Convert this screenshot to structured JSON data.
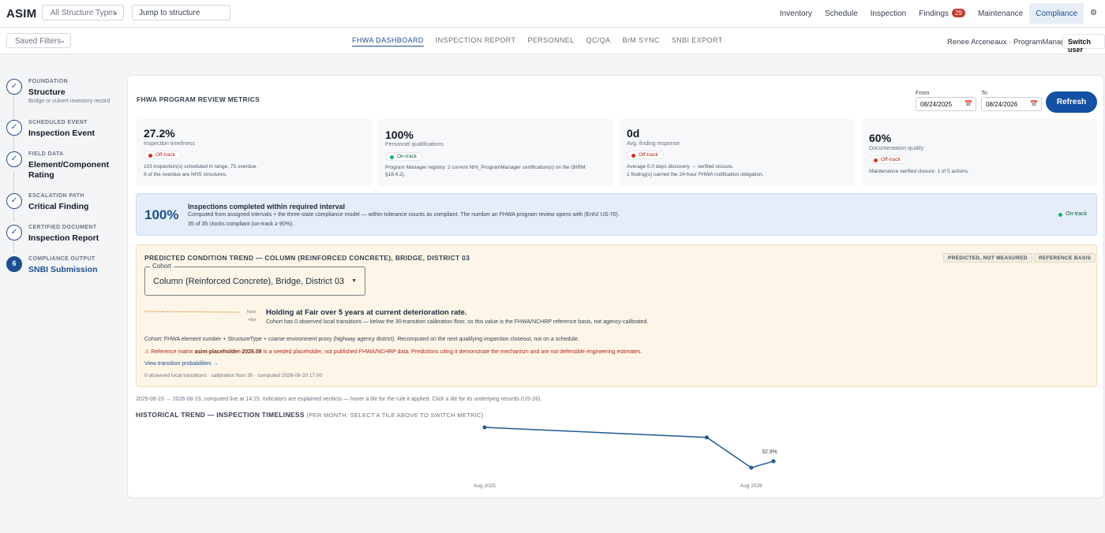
{
  "brand": "ASIM",
  "structure_select": "All Structure Types",
  "jump_placeholder": "Jump to structure",
  "topnav": {
    "inventory": "Inventory",
    "schedule": "Schedule",
    "inspection": "Inspection",
    "findings": "Findings",
    "findings_count": "29",
    "maintenance": "Maintenance",
    "compliance": "Compliance",
    "settings_icon": "gear-icon"
  },
  "subbar": {
    "saved_filters": "Saved Filters",
    "tabs": [
      "FHWA DASHBOARD",
      "INSPECTION REPORT",
      "PERSONNEL",
      "QC/QA",
      "BrM SYNC",
      "SNBI EXPORT"
    ],
    "active_tab": "FHWA DASHBOARD",
    "user": "Renee Arceneaux · ProgramManager",
    "switch_user": "Switch user"
  },
  "stepper": [
    {
      "category": "FOUNDATION",
      "title": "Structure",
      "desc": "Bridge or culvert inventory record",
      "mark": "✓"
    },
    {
      "category": "SCHEDULED EVENT",
      "title": "Inspection Event",
      "mark": "✓"
    },
    {
      "category": "FIELD DATA",
      "title": "Element/Component Rating",
      "mark": "✓"
    },
    {
      "category": "ESCALATION PATH",
      "title": "Critical Finding",
      "mark": "✓"
    },
    {
      "category": "CERTIFIED DOCUMENT",
      "title": "Inspection Report",
      "mark": "✓"
    },
    {
      "category": "COMPLIANCE OUTPUT",
      "title": "SNBI Submission",
      "mark": "6"
    }
  ],
  "dashboard": {
    "title": "FHWA PROGRAM REVIEW METRICS",
    "from_label": "From",
    "from_value": "08/24/2025",
    "to_label": "To",
    "to_value": "08/24/2026",
    "refresh": "Refresh"
  },
  "metrics": [
    {
      "value": "27.2%",
      "label": "Inspection timeliness",
      "status": "Off-track",
      "status_type": "off",
      "notes": [
        "103 inspection(s) scheduled in range, 75 overdue.",
        "9 of the overdue are NHS structures."
      ]
    },
    {
      "value": "100%",
      "label": "Personnel qualifications",
      "status": "On-track",
      "status_type": "on",
      "notes": [
        "Program Manager registry: 2 current NHI_ProgramManager certification(s) on file (BIRM",
        "§18.4.2)."
      ]
    },
    {
      "value": "0d",
      "label": "Avg. finding response",
      "status": "Off-track",
      "status_type": "off",
      "notes": [
        "Average 0.0 days discovery → verified closure.",
        "1 finding(s) carried the 24-hour FHWA notification obligation."
      ]
    },
    {
      "value": "60%",
      "label": "Documentation quality",
      "status": "Off-track",
      "status_type": "off",
      "notes": [
        "Maintenance verified closure: 1 of 5 actions."
      ]
    }
  ],
  "banner": {
    "value": "100%",
    "title": "Inspections completed within required interval",
    "desc": "Computed from assigned intervals + the three-state compliance model — within-tolerance counts as compliant. The number an FHWA program review opens with (Enh2 US-70).",
    "sub": "35 of 35 clocks compliant (on-track ≥ 90%).",
    "status": "On-track"
  },
  "trend": {
    "title": "PREDICTED CONDITION TREND — COLUMN (REINFORCED CONCRETE), BRIDGE, DISTRICT 03",
    "tag1": "PREDICTED, NOT MEASURED",
    "tag2": "REFERENCE BASIS",
    "cohort_label": "Cohort",
    "cohort_value": "Column (Reinforced Concrete), Bridge, District 03",
    "spark_now": "Now",
    "spark_5y": "+5yr",
    "headline": "Holding at Fair over 5 years at current deterioration rate.",
    "headline_desc": "Cohort has 0 observed local transitions — below the 30-transition calibration floor, so this value is the FHWA/NCHRP reference basis, not agency-calibrated.",
    "cohort_note": "Cohort: FHWA element number + StructureType + coarse environment proxy (highway agency district). Recomputed on the next qualifying inspection closeout, not on a schedule.",
    "warn_pre": "⚠ Reference matrix ",
    "warn_bold": "asim-placeholder-2026.08",
    "warn_post": " is a seeded placeholder, not published FHWA/NCHRP data. Predictions citing it demonstrate the mechanism and are not defensible engineering estimates.",
    "link": "View transition probabilities →",
    "footer": "0 observed local transitions · calibration floor 30 · computed 2026-08-20 17:00"
  },
  "range_note": "2025-08-23 → 2026-08-23, computed live at 14:15. Indicators are explained verdicts — hover a tile for the rule it applied. Click a tile for its underlying records (US-26).",
  "history": {
    "title": "HISTORICAL TREND — INSPECTION TIMELINESS",
    "subtitle": "(PER MONTH; SELECT A TILE ABOVE TO SWITCH METRIC)"
  },
  "chart_data": {
    "type": "line",
    "x_labels": [
      "Aug 2025",
      "Aug 2026"
    ],
    "series": [
      {
        "values": [
          null,
          null,
          null,
          null,
          null,
          null,
          null,
          null,
          null,
          null,
          null,
          null,
          null
        ]
      }
    ],
    "points": [
      {
        "x": "2025-08",
        "y": 100
      },
      {
        "x": "2026-06",
        "y": 80
      },
      {
        "x": "2026-08",
        "y": 20
      },
      {
        "x": "2026-09",
        "y": 32.9
      }
    ],
    "data_labels": [
      {
        "x": "2026-09",
        "text": "32.9%"
      }
    ],
    "ylim": [
      0,
      100
    ],
    "grid": false,
    "line_color": "#1d5a96"
  }
}
